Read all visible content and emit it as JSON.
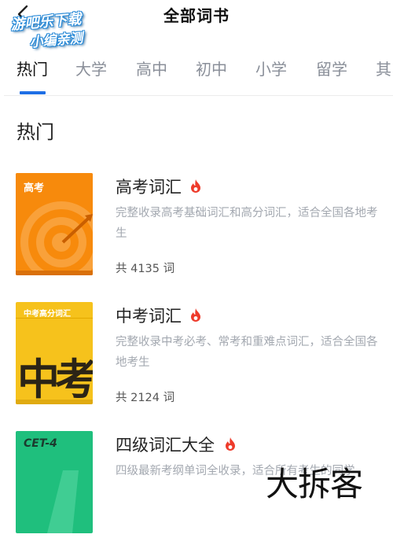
{
  "header": {
    "title": "全部词书",
    "watermark_line1": "游吧乐下载",
    "watermark_line2": "小编亲测"
  },
  "tabs": [
    {
      "label": "热门"
    },
    {
      "label": "大学"
    },
    {
      "label": "高中"
    },
    {
      "label": "初中"
    },
    {
      "label": "小学"
    },
    {
      "label": "留学"
    },
    {
      "label": "其"
    }
  ],
  "section": {
    "title": "热门"
  },
  "books": [
    {
      "cover_text": "高考",
      "title": "高考词汇",
      "description": "完整收录高考基础词汇和高分词汇，适合全国各地考生",
      "count": "共 4135 词"
    },
    {
      "cover_text": "中考高分词汇",
      "cover_big": "中考",
      "title": "中考词汇",
      "description": "完整收录中考必考、常考和重难点词汇，适合全国各地考生",
      "count": "共 2124 词"
    },
    {
      "cover_text": "CET-4",
      "title": "四级词汇大全",
      "description": "四级最新考纲单词全收录，适合所有考生的同学"
    }
  ],
  "overlay_brand": "大拆客",
  "colors": {
    "accent": "#1f6fe5",
    "flame": "#ee3b2b",
    "cover_gaokao": "#f78a0c",
    "cover_zhongkao": "#f6c21c",
    "cover_cet4": "#1fbf7d"
  }
}
